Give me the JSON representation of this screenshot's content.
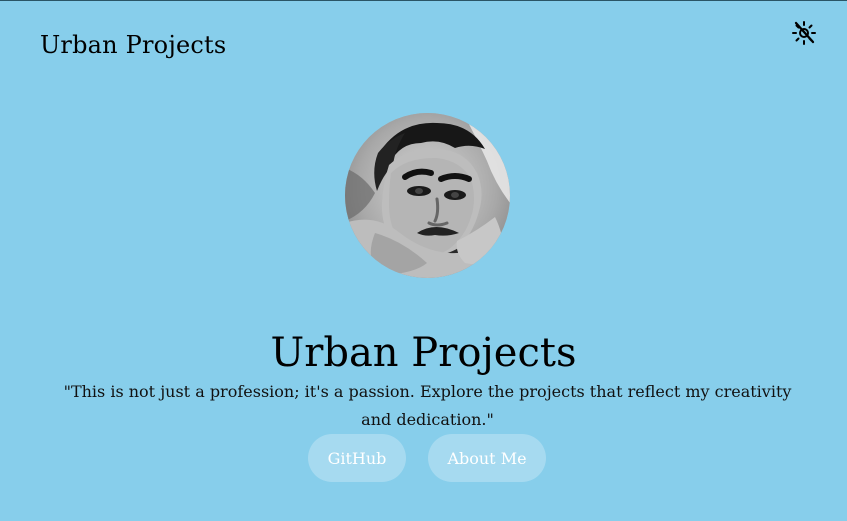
{
  "navbar": {
    "brand": "Urban Projects",
    "theme_toggle_icon": "sun-moon-icon"
  },
  "hero": {
    "avatar_icon": "profile-photo",
    "title": "Urban Projects",
    "subtitle": "\"This is not just a profession; it's a passion. Explore the projects that reflect my creativity and dedication.\""
  },
  "buttons": {
    "github_label": "GitHub",
    "about_label": "About Me"
  },
  "colors": {
    "background": "#87CEEB",
    "button_bg": "rgba(255,255,255,0.26)",
    "button_text": "#FFFFFF",
    "text": "#000000"
  }
}
